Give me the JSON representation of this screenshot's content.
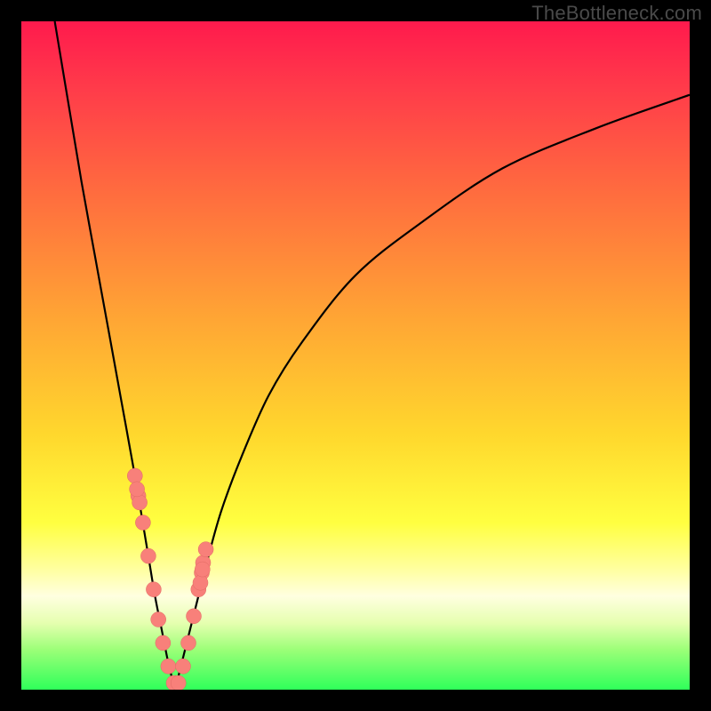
{
  "watermark": "TheBottleneck.com",
  "colors": {
    "background_frame": "#000000",
    "curve": "#000000",
    "dot_fill": "#f8807a",
    "dot_stroke": "#e06a62",
    "gradient_stops": [
      "#ff1a4d",
      "#ff3b4a",
      "#ff6a3f",
      "#ffa734",
      "#ffd82d",
      "#ffff40",
      "#ffffa0",
      "#ffffe0",
      "#e6ffb0",
      "#9cff78",
      "#2fff5a"
    ]
  },
  "chart_data": {
    "type": "line",
    "title": "",
    "xlabel": "",
    "ylabel": "",
    "xlim": [
      0,
      100
    ],
    "ylim": [
      0,
      100
    ],
    "notes": "V-shaped bottleneck curve. Minimum (≈0) at x≈23. Left branch rises steeply to ≈100 at x=0; right branch rises with decreasing slope to ≈90 at x=100. Pink dots mark sample points clustered near the minimum on both branches.",
    "series": [
      {
        "name": "curve_left_branch",
        "x": [
          5,
          7,
          9,
          11,
          13,
          15,
          17,
          18,
          19,
          20,
          21,
          22,
          23
        ],
        "y": [
          100,
          88,
          76,
          65,
          54,
          43,
          32,
          26,
          20,
          14,
          9,
          4,
          0
        ]
      },
      {
        "name": "curve_right_branch",
        "x": [
          23,
          24,
          25,
          26,
          27,
          28,
          30,
          33,
          37,
          42,
          50,
          60,
          72,
          86,
          100
        ],
        "y": [
          0,
          4,
          8,
          12,
          16,
          20,
          27,
          35,
          44,
          52,
          62,
          70,
          78,
          84,
          89
        ]
      },
      {
        "name": "sample_dots",
        "x": [
          17.0,
          17.5,
          17.7,
          17.3,
          18.2,
          19.0,
          19.8,
          20.5,
          21.2,
          22.0,
          22.8,
          23.5,
          24.2,
          25.0,
          25.8,
          26.5,
          27.0,
          27.2,
          26.8,
          27.6,
          27.1
        ],
        "y": [
          32.0,
          29.0,
          28.0,
          30.0,
          25.0,
          20.0,
          15.0,
          10.5,
          7.0,
          3.5,
          1.0,
          1.0,
          3.5,
          7.0,
          11.0,
          15.0,
          17.5,
          19.0,
          16.0,
          21.0,
          18.0
        ]
      }
    ]
  }
}
